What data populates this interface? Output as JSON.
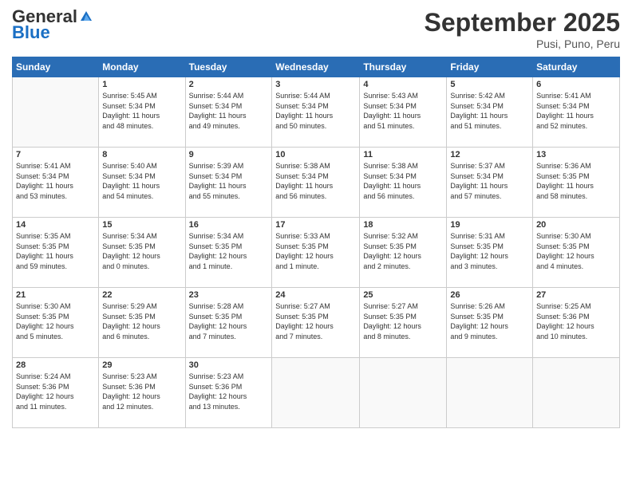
{
  "logo": {
    "line1": "General",
    "line2": "Blue"
  },
  "header": {
    "month": "September 2025",
    "location": "Pusi, Puno, Peru"
  },
  "weekdays": [
    "Sunday",
    "Monday",
    "Tuesday",
    "Wednesday",
    "Thursday",
    "Friday",
    "Saturday"
  ],
  "weeks": [
    [
      {
        "day": "",
        "info": ""
      },
      {
        "day": "1",
        "info": "Sunrise: 5:45 AM\nSunset: 5:34 PM\nDaylight: 11 hours\nand 48 minutes."
      },
      {
        "day": "2",
        "info": "Sunrise: 5:44 AM\nSunset: 5:34 PM\nDaylight: 11 hours\nand 49 minutes."
      },
      {
        "day": "3",
        "info": "Sunrise: 5:44 AM\nSunset: 5:34 PM\nDaylight: 11 hours\nand 50 minutes."
      },
      {
        "day": "4",
        "info": "Sunrise: 5:43 AM\nSunset: 5:34 PM\nDaylight: 11 hours\nand 51 minutes."
      },
      {
        "day": "5",
        "info": "Sunrise: 5:42 AM\nSunset: 5:34 PM\nDaylight: 11 hours\nand 51 minutes."
      },
      {
        "day": "6",
        "info": "Sunrise: 5:41 AM\nSunset: 5:34 PM\nDaylight: 11 hours\nand 52 minutes."
      }
    ],
    [
      {
        "day": "7",
        "info": "Sunrise: 5:41 AM\nSunset: 5:34 PM\nDaylight: 11 hours\nand 53 minutes."
      },
      {
        "day": "8",
        "info": "Sunrise: 5:40 AM\nSunset: 5:34 PM\nDaylight: 11 hours\nand 54 minutes."
      },
      {
        "day": "9",
        "info": "Sunrise: 5:39 AM\nSunset: 5:34 PM\nDaylight: 11 hours\nand 55 minutes."
      },
      {
        "day": "10",
        "info": "Sunrise: 5:38 AM\nSunset: 5:34 PM\nDaylight: 11 hours\nand 56 minutes."
      },
      {
        "day": "11",
        "info": "Sunrise: 5:38 AM\nSunset: 5:34 PM\nDaylight: 11 hours\nand 56 minutes."
      },
      {
        "day": "12",
        "info": "Sunrise: 5:37 AM\nSunset: 5:34 PM\nDaylight: 11 hours\nand 57 minutes."
      },
      {
        "day": "13",
        "info": "Sunrise: 5:36 AM\nSunset: 5:35 PM\nDaylight: 11 hours\nand 58 minutes."
      }
    ],
    [
      {
        "day": "14",
        "info": "Sunrise: 5:35 AM\nSunset: 5:35 PM\nDaylight: 11 hours\nand 59 minutes."
      },
      {
        "day": "15",
        "info": "Sunrise: 5:34 AM\nSunset: 5:35 PM\nDaylight: 12 hours\nand 0 minutes."
      },
      {
        "day": "16",
        "info": "Sunrise: 5:34 AM\nSunset: 5:35 PM\nDaylight: 12 hours\nand 1 minute."
      },
      {
        "day": "17",
        "info": "Sunrise: 5:33 AM\nSunset: 5:35 PM\nDaylight: 12 hours\nand 1 minute."
      },
      {
        "day": "18",
        "info": "Sunrise: 5:32 AM\nSunset: 5:35 PM\nDaylight: 12 hours\nand 2 minutes."
      },
      {
        "day": "19",
        "info": "Sunrise: 5:31 AM\nSunset: 5:35 PM\nDaylight: 12 hours\nand 3 minutes."
      },
      {
        "day": "20",
        "info": "Sunrise: 5:30 AM\nSunset: 5:35 PM\nDaylight: 12 hours\nand 4 minutes."
      }
    ],
    [
      {
        "day": "21",
        "info": "Sunrise: 5:30 AM\nSunset: 5:35 PM\nDaylight: 12 hours\nand 5 minutes."
      },
      {
        "day": "22",
        "info": "Sunrise: 5:29 AM\nSunset: 5:35 PM\nDaylight: 12 hours\nand 6 minutes."
      },
      {
        "day": "23",
        "info": "Sunrise: 5:28 AM\nSunset: 5:35 PM\nDaylight: 12 hours\nand 7 minutes."
      },
      {
        "day": "24",
        "info": "Sunrise: 5:27 AM\nSunset: 5:35 PM\nDaylight: 12 hours\nand 7 minutes."
      },
      {
        "day": "25",
        "info": "Sunrise: 5:27 AM\nSunset: 5:35 PM\nDaylight: 12 hours\nand 8 minutes."
      },
      {
        "day": "26",
        "info": "Sunrise: 5:26 AM\nSunset: 5:35 PM\nDaylight: 12 hours\nand 9 minutes."
      },
      {
        "day": "27",
        "info": "Sunrise: 5:25 AM\nSunset: 5:36 PM\nDaylight: 12 hours\nand 10 minutes."
      }
    ],
    [
      {
        "day": "28",
        "info": "Sunrise: 5:24 AM\nSunset: 5:36 PM\nDaylight: 12 hours\nand 11 minutes."
      },
      {
        "day": "29",
        "info": "Sunrise: 5:23 AM\nSunset: 5:36 PM\nDaylight: 12 hours\nand 12 minutes."
      },
      {
        "day": "30",
        "info": "Sunrise: 5:23 AM\nSunset: 5:36 PM\nDaylight: 12 hours\nand 13 minutes."
      },
      {
        "day": "",
        "info": ""
      },
      {
        "day": "",
        "info": ""
      },
      {
        "day": "",
        "info": ""
      },
      {
        "day": "",
        "info": ""
      }
    ]
  ]
}
